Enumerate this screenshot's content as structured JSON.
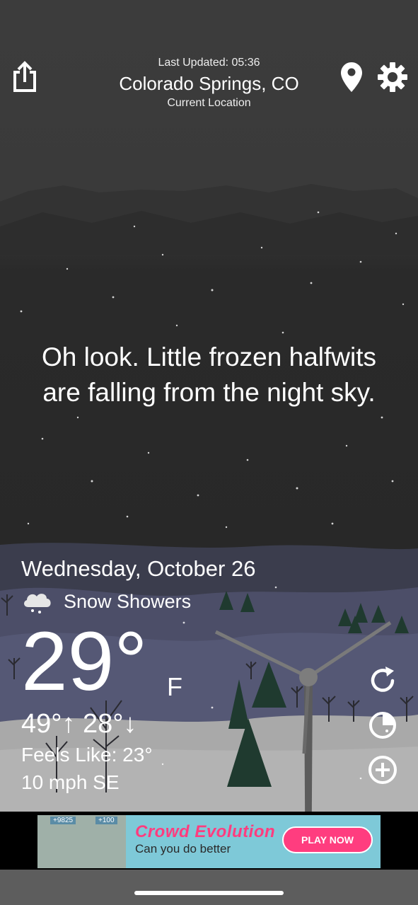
{
  "header": {
    "last_updated": "Last Updated: 05:36",
    "city": "Colorado Springs, CO",
    "location_label": "Current Location",
    "share_icon": "share-icon",
    "pin_icon": "location-pin-icon",
    "settings_icon": "gear-icon"
  },
  "quote": {
    "line1": "Oh look. Little frozen halfwits",
    "line2": "are falling from the night sky."
  },
  "weather": {
    "date": "Wednesday, October 26",
    "condition_icon": "snow-cloud-icon",
    "condition": "Snow Showers",
    "temperature": "29°",
    "unit": "F",
    "high_low": "49°↑ 28°↓",
    "feels_like": "Feels Like: 23°",
    "wind": "10 mph SE"
  },
  "actions": {
    "refresh_icon": "refresh-icon",
    "radar_icon": "radar-icon",
    "add_icon": "add-icon"
  },
  "ad": {
    "title": "Crowd Evolution",
    "subtitle": "Can you do better",
    "cta": "PLAY NOW",
    "badge1": "+9825",
    "badge2": "+100"
  },
  "colors": {
    "sky_top": "#3a3a3a",
    "sky_bottom": "#262626",
    "hills": "#4a4c62",
    "snow_ground": "#b9b9b9",
    "ad_bg": "#7ec9d8",
    "ad_accent": "#ff3d7f"
  }
}
